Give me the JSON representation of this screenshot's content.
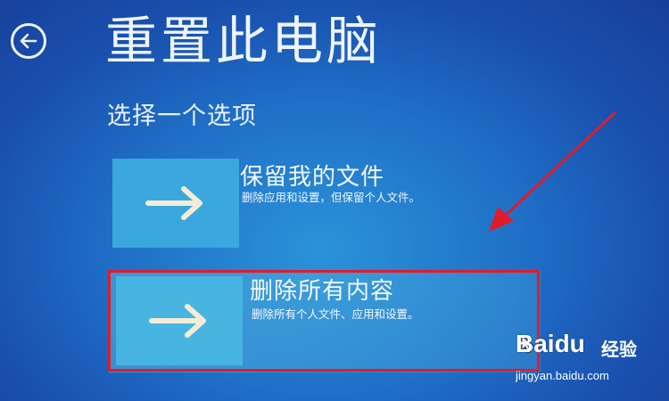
{
  "header": {
    "title": "重置此电脑",
    "subtitle": "选择一个选项"
  },
  "options": [
    {
      "title": "保留我的文件",
      "description": "删除应用和设置，但保留个人文件。"
    },
    {
      "title": "删除所有内容",
      "description": "删除所有个人文件、应用和设置。"
    }
  ],
  "watermark": {
    "brand": "Baidu",
    "service": "经验",
    "url": "jingyan.baidu.com"
  },
  "colors": {
    "background": "#1f6fc6",
    "tile": "#3aa8dc",
    "annotation": "#e01c2b"
  }
}
